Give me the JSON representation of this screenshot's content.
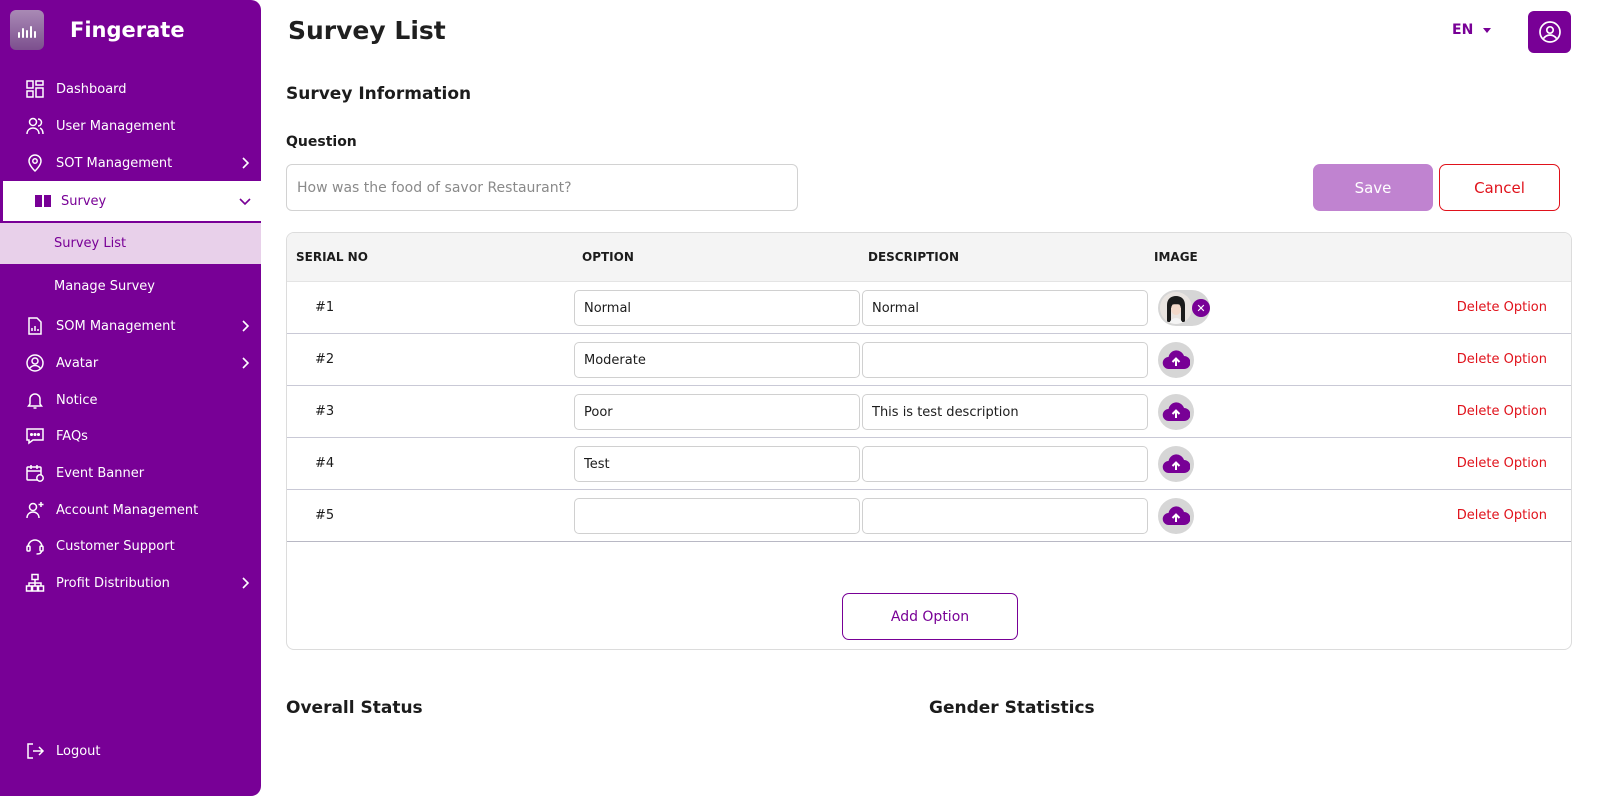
{
  "brand": {
    "name": "Fingerate"
  },
  "sidebar": {
    "items": [
      {
        "label": "Dashboard"
      },
      {
        "label": "User Management"
      },
      {
        "label": "SOT Management"
      },
      {
        "label": "Survey"
      },
      {
        "label": "SOM Management"
      },
      {
        "label": "Avatar"
      },
      {
        "label": "Notice"
      },
      {
        "label": "FAQs"
      },
      {
        "label": "Event Banner"
      },
      {
        "label": "Account Management"
      },
      {
        "label": "Customer Support"
      },
      {
        "label": "Profit Distribution"
      }
    ],
    "sub_items": [
      {
        "label": "Survey List"
      },
      {
        "label": "Manage Survey"
      }
    ],
    "logout": "Logout"
  },
  "header": {
    "title": "Survey List",
    "language": "EN"
  },
  "form": {
    "section_title": "Survey Information",
    "question_label": "Question",
    "question_placeholder": "How was the food of savor Restaurant?",
    "save_label": "Save",
    "cancel_label": "Cancel"
  },
  "table": {
    "columns": [
      "SERIAL NO",
      "OPTION",
      "DESCRIPTION",
      "IMAGE"
    ],
    "rows": [
      {
        "serial": "#1",
        "option": "Normal",
        "description": "Normal",
        "has_image": true,
        "delete": "Delete Option"
      },
      {
        "serial": "#2",
        "option": "Moderate",
        "description": "",
        "has_image": false,
        "delete": "Delete Option"
      },
      {
        "serial": "#3",
        "option": "Poor",
        "description": "This is test description",
        "has_image": false,
        "delete": "Delete Option"
      },
      {
        "serial": "#4",
        "option": "Test",
        "description": "",
        "has_image": false,
        "delete": "Delete Option"
      },
      {
        "serial": "#5",
        "option": "",
        "description": "",
        "has_image": false,
        "delete": "Delete Option"
      }
    ],
    "add_label": "Add Option"
  },
  "sections": {
    "overall_status": "Overall Status",
    "gender_statistics": "Gender Statistics"
  },
  "colors": {
    "primary": "#780096",
    "danger": "#e0121b",
    "save_disabled": "#c083d0",
    "active_sub": "#e8d0ea"
  },
  "icons": [
    "dashboard-icon",
    "users-icon",
    "location-pin-icon",
    "book-icon",
    "document-chart-icon",
    "avatar-icon",
    "bell-icon",
    "chat-icon",
    "calendar-icon",
    "add-user-icon",
    "headset-icon",
    "hierarchy-icon",
    "logout-icon",
    "user-circle-icon",
    "upload-cloud-icon",
    "close-icon"
  ]
}
